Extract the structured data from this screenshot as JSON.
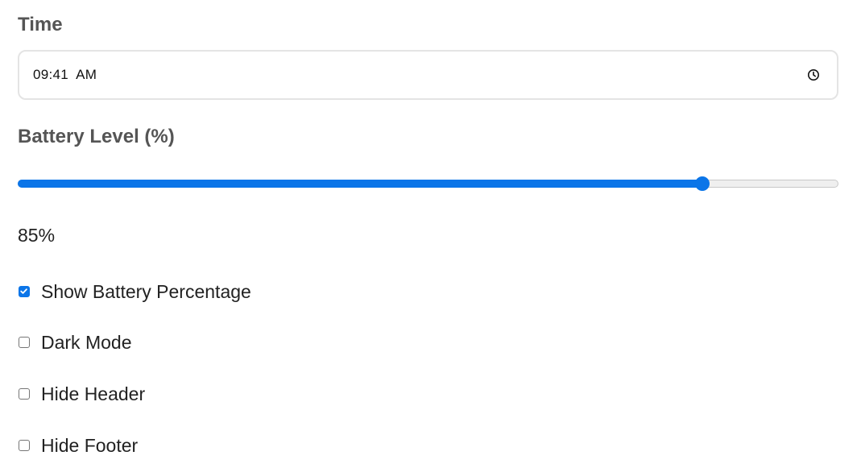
{
  "time": {
    "label": "Time",
    "value": "09:41  AM",
    "icon": "clock-icon"
  },
  "battery": {
    "label": "Battery Level (%)",
    "value": 85,
    "value_text": "85%",
    "accent_color": "#0b75e8"
  },
  "options": [
    {
      "label": "Show Battery Percentage",
      "checked": true
    },
    {
      "label": "Dark Mode",
      "checked": false
    },
    {
      "label": "Hide Header",
      "checked": false
    },
    {
      "label": "Hide Footer",
      "checked": false
    }
  ]
}
